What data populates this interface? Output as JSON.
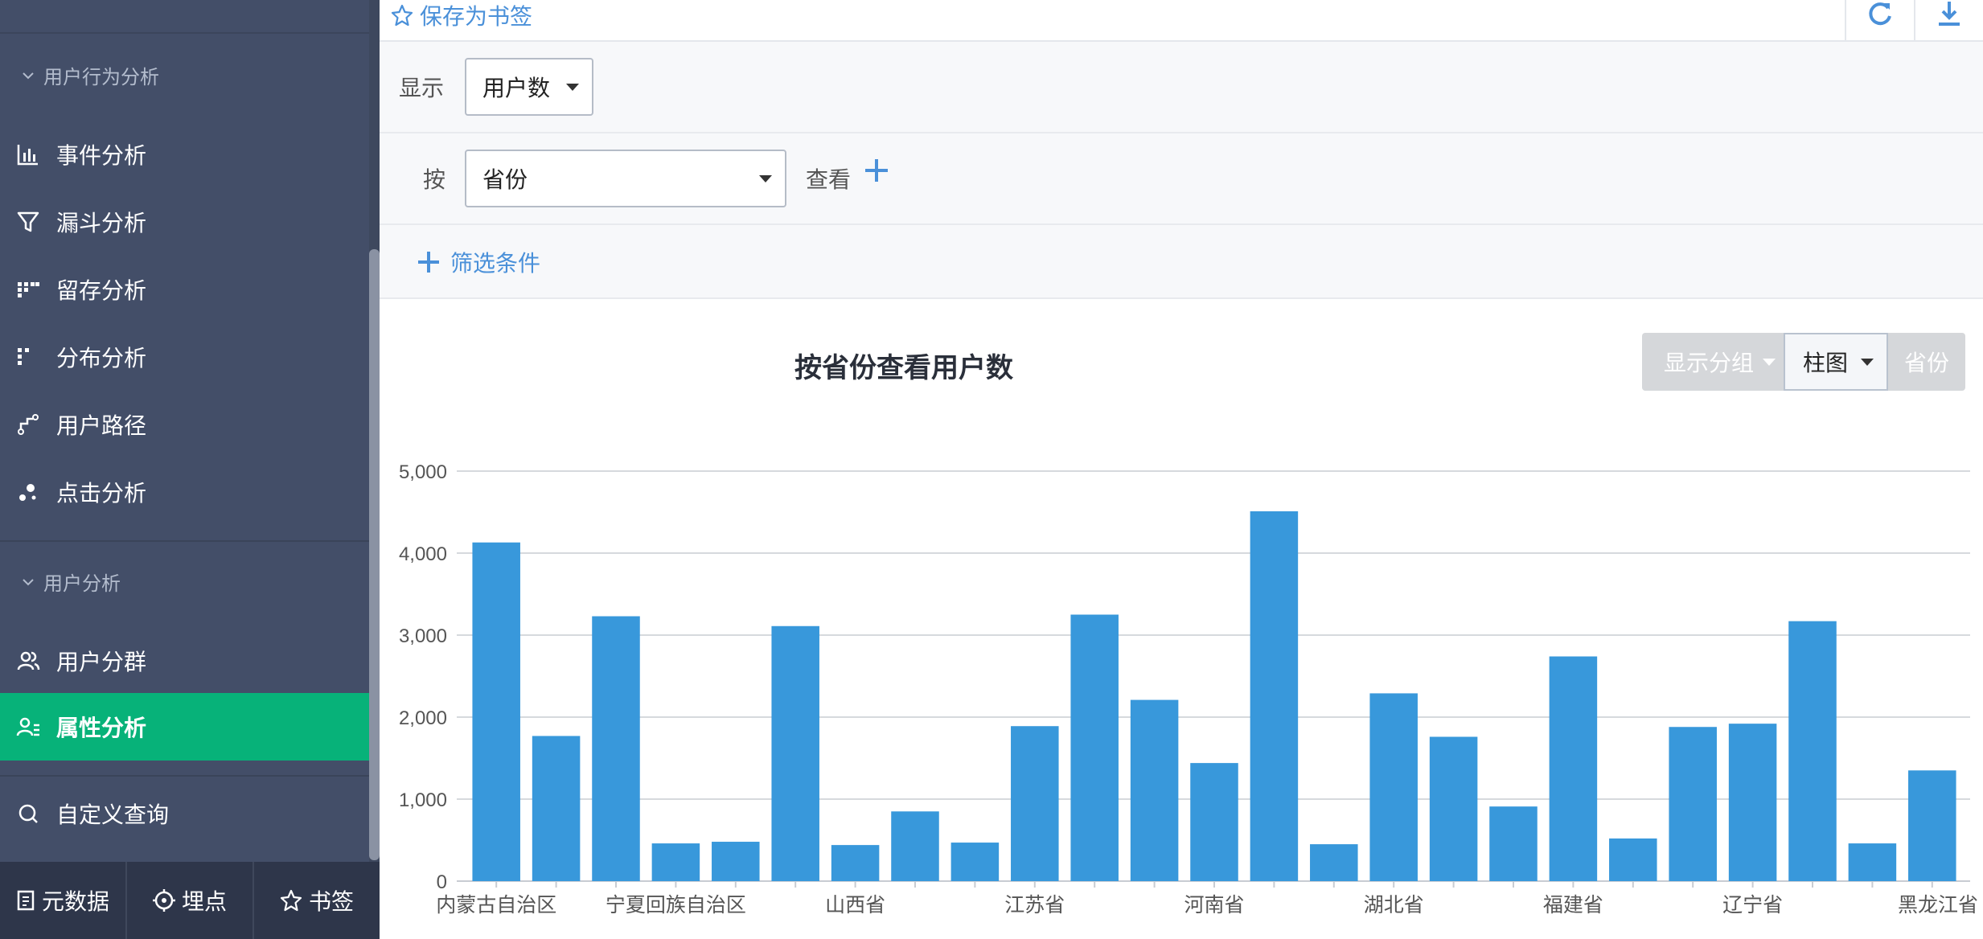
{
  "sidebar": {
    "section1_title": "用户行为分析",
    "section2_title": "用户分析",
    "items": [
      {
        "label": "事件分析"
      },
      {
        "label": "漏斗分析"
      },
      {
        "label": "留存分析"
      },
      {
        "label": "分布分析"
      },
      {
        "label": "用户路径"
      },
      {
        "label": "点击分析"
      },
      {
        "label": "用户分群"
      },
      {
        "label": "属性分析"
      },
      {
        "label": "自定义查询"
      }
    ],
    "bottom": [
      {
        "label": "元数据"
      },
      {
        "label": "埋点"
      },
      {
        "label": "书签"
      }
    ]
  },
  "toolbar": {
    "bookmark_label": "保存为书签"
  },
  "filters": {
    "show_label": "显示",
    "metric_value": "用户数",
    "by_label": "按",
    "group_value": "省份",
    "view_label": "查看",
    "filter_label": "筛选条件"
  },
  "chart_controls": {
    "group_btn": "显示分组",
    "chart_type": "柱图",
    "dimension_btn": "省份"
  },
  "colors": {
    "accent": "#4a90d9",
    "active": "#07b279",
    "bar": "#3898db"
  },
  "chart_data": {
    "type": "bar",
    "title": "按省份查看用户数",
    "ylim": [
      0,
      5000
    ],
    "yticks": [
      "0",
      "1,000",
      "2,000",
      "3,000",
      "4,000",
      "5,000"
    ],
    "grid": true,
    "values": [
      4130,
      1770,
      3230,
      460,
      480,
      3110,
      440,
      850,
      470,
      1890,
      3250,
      2210,
      1440,
      4510,
      450,
      2290,
      1760,
      910,
      2740,
      520,
      1880,
      1920,
      3170,
      460,
      1350
    ],
    "xtick_labels": [
      {
        "index": 0,
        "label": "内蒙古自治区"
      },
      {
        "index": 3,
        "label": "宁夏回族自治区"
      },
      {
        "index": 6,
        "label": "山西省"
      },
      {
        "index": 9,
        "label": "江苏省"
      },
      {
        "index": 12,
        "label": "河南省"
      },
      {
        "index": 15,
        "label": "湖北省"
      },
      {
        "index": 18,
        "label": "福建省"
      },
      {
        "index": 21,
        "label": "辽宁省"
      },
      {
        "index": 24,
        "label": "黑龙江省"
      }
    ]
  }
}
